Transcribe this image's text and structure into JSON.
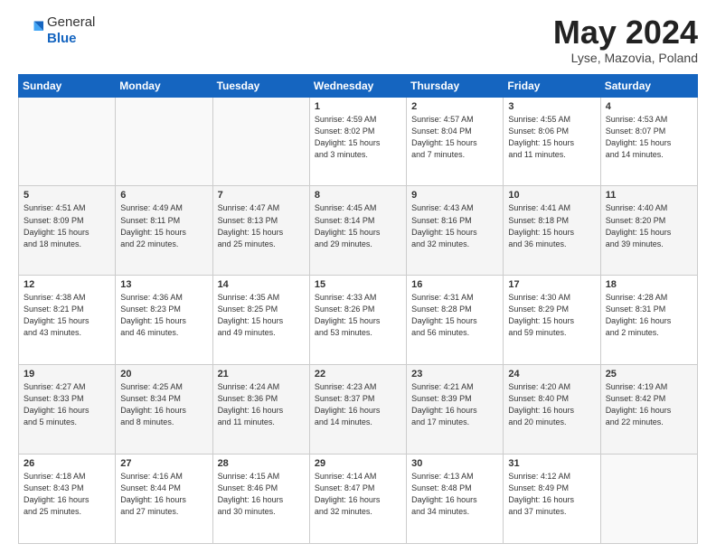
{
  "header": {
    "logo_general": "General",
    "logo_blue": "Blue",
    "month_title": "May 2024",
    "location": "Lyse, Mazovia, Poland"
  },
  "days_of_week": [
    "Sunday",
    "Monday",
    "Tuesday",
    "Wednesday",
    "Thursday",
    "Friday",
    "Saturday"
  ],
  "weeks": [
    [
      {
        "num": "",
        "info": ""
      },
      {
        "num": "",
        "info": ""
      },
      {
        "num": "",
        "info": ""
      },
      {
        "num": "1",
        "info": "Sunrise: 4:59 AM\nSunset: 8:02 PM\nDaylight: 15 hours\nand 3 minutes."
      },
      {
        "num": "2",
        "info": "Sunrise: 4:57 AM\nSunset: 8:04 PM\nDaylight: 15 hours\nand 7 minutes."
      },
      {
        "num": "3",
        "info": "Sunrise: 4:55 AM\nSunset: 8:06 PM\nDaylight: 15 hours\nand 11 minutes."
      },
      {
        "num": "4",
        "info": "Sunrise: 4:53 AM\nSunset: 8:07 PM\nDaylight: 15 hours\nand 14 minutes."
      }
    ],
    [
      {
        "num": "5",
        "info": "Sunrise: 4:51 AM\nSunset: 8:09 PM\nDaylight: 15 hours\nand 18 minutes."
      },
      {
        "num": "6",
        "info": "Sunrise: 4:49 AM\nSunset: 8:11 PM\nDaylight: 15 hours\nand 22 minutes."
      },
      {
        "num": "7",
        "info": "Sunrise: 4:47 AM\nSunset: 8:13 PM\nDaylight: 15 hours\nand 25 minutes."
      },
      {
        "num": "8",
        "info": "Sunrise: 4:45 AM\nSunset: 8:14 PM\nDaylight: 15 hours\nand 29 minutes."
      },
      {
        "num": "9",
        "info": "Sunrise: 4:43 AM\nSunset: 8:16 PM\nDaylight: 15 hours\nand 32 minutes."
      },
      {
        "num": "10",
        "info": "Sunrise: 4:41 AM\nSunset: 8:18 PM\nDaylight: 15 hours\nand 36 minutes."
      },
      {
        "num": "11",
        "info": "Sunrise: 4:40 AM\nSunset: 8:20 PM\nDaylight: 15 hours\nand 39 minutes."
      }
    ],
    [
      {
        "num": "12",
        "info": "Sunrise: 4:38 AM\nSunset: 8:21 PM\nDaylight: 15 hours\nand 43 minutes."
      },
      {
        "num": "13",
        "info": "Sunrise: 4:36 AM\nSunset: 8:23 PM\nDaylight: 15 hours\nand 46 minutes."
      },
      {
        "num": "14",
        "info": "Sunrise: 4:35 AM\nSunset: 8:25 PM\nDaylight: 15 hours\nand 49 minutes."
      },
      {
        "num": "15",
        "info": "Sunrise: 4:33 AM\nSunset: 8:26 PM\nDaylight: 15 hours\nand 53 minutes."
      },
      {
        "num": "16",
        "info": "Sunrise: 4:31 AM\nSunset: 8:28 PM\nDaylight: 15 hours\nand 56 minutes."
      },
      {
        "num": "17",
        "info": "Sunrise: 4:30 AM\nSunset: 8:29 PM\nDaylight: 15 hours\nand 59 minutes."
      },
      {
        "num": "18",
        "info": "Sunrise: 4:28 AM\nSunset: 8:31 PM\nDaylight: 16 hours\nand 2 minutes."
      }
    ],
    [
      {
        "num": "19",
        "info": "Sunrise: 4:27 AM\nSunset: 8:33 PM\nDaylight: 16 hours\nand 5 minutes."
      },
      {
        "num": "20",
        "info": "Sunrise: 4:25 AM\nSunset: 8:34 PM\nDaylight: 16 hours\nand 8 minutes."
      },
      {
        "num": "21",
        "info": "Sunrise: 4:24 AM\nSunset: 8:36 PM\nDaylight: 16 hours\nand 11 minutes."
      },
      {
        "num": "22",
        "info": "Sunrise: 4:23 AM\nSunset: 8:37 PM\nDaylight: 16 hours\nand 14 minutes."
      },
      {
        "num": "23",
        "info": "Sunrise: 4:21 AM\nSunset: 8:39 PM\nDaylight: 16 hours\nand 17 minutes."
      },
      {
        "num": "24",
        "info": "Sunrise: 4:20 AM\nSunset: 8:40 PM\nDaylight: 16 hours\nand 20 minutes."
      },
      {
        "num": "25",
        "info": "Sunrise: 4:19 AM\nSunset: 8:42 PM\nDaylight: 16 hours\nand 22 minutes."
      }
    ],
    [
      {
        "num": "26",
        "info": "Sunrise: 4:18 AM\nSunset: 8:43 PM\nDaylight: 16 hours\nand 25 minutes."
      },
      {
        "num": "27",
        "info": "Sunrise: 4:16 AM\nSunset: 8:44 PM\nDaylight: 16 hours\nand 27 minutes."
      },
      {
        "num": "28",
        "info": "Sunrise: 4:15 AM\nSunset: 8:46 PM\nDaylight: 16 hours\nand 30 minutes."
      },
      {
        "num": "29",
        "info": "Sunrise: 4:14 AM\nSunset: 8:47 PM\nDaylight: 16 hours\nand 32 minutes."
      },
      {
        "num": "30",
        "info": "Sunrise: 4:13 AM\nSunset: 8:48 PM\nDaylight: 16 hours\nand 34 minutes."
      },
      {
        "num": "31",
        "info": "Sunrise: 4:12 AM\nSunset: 8:49 PM\nDaylight: 16 hours\nand 37 minutes."
      },
      {
        "num": "",
        "info": ""
      }
    ]
  ]
}
